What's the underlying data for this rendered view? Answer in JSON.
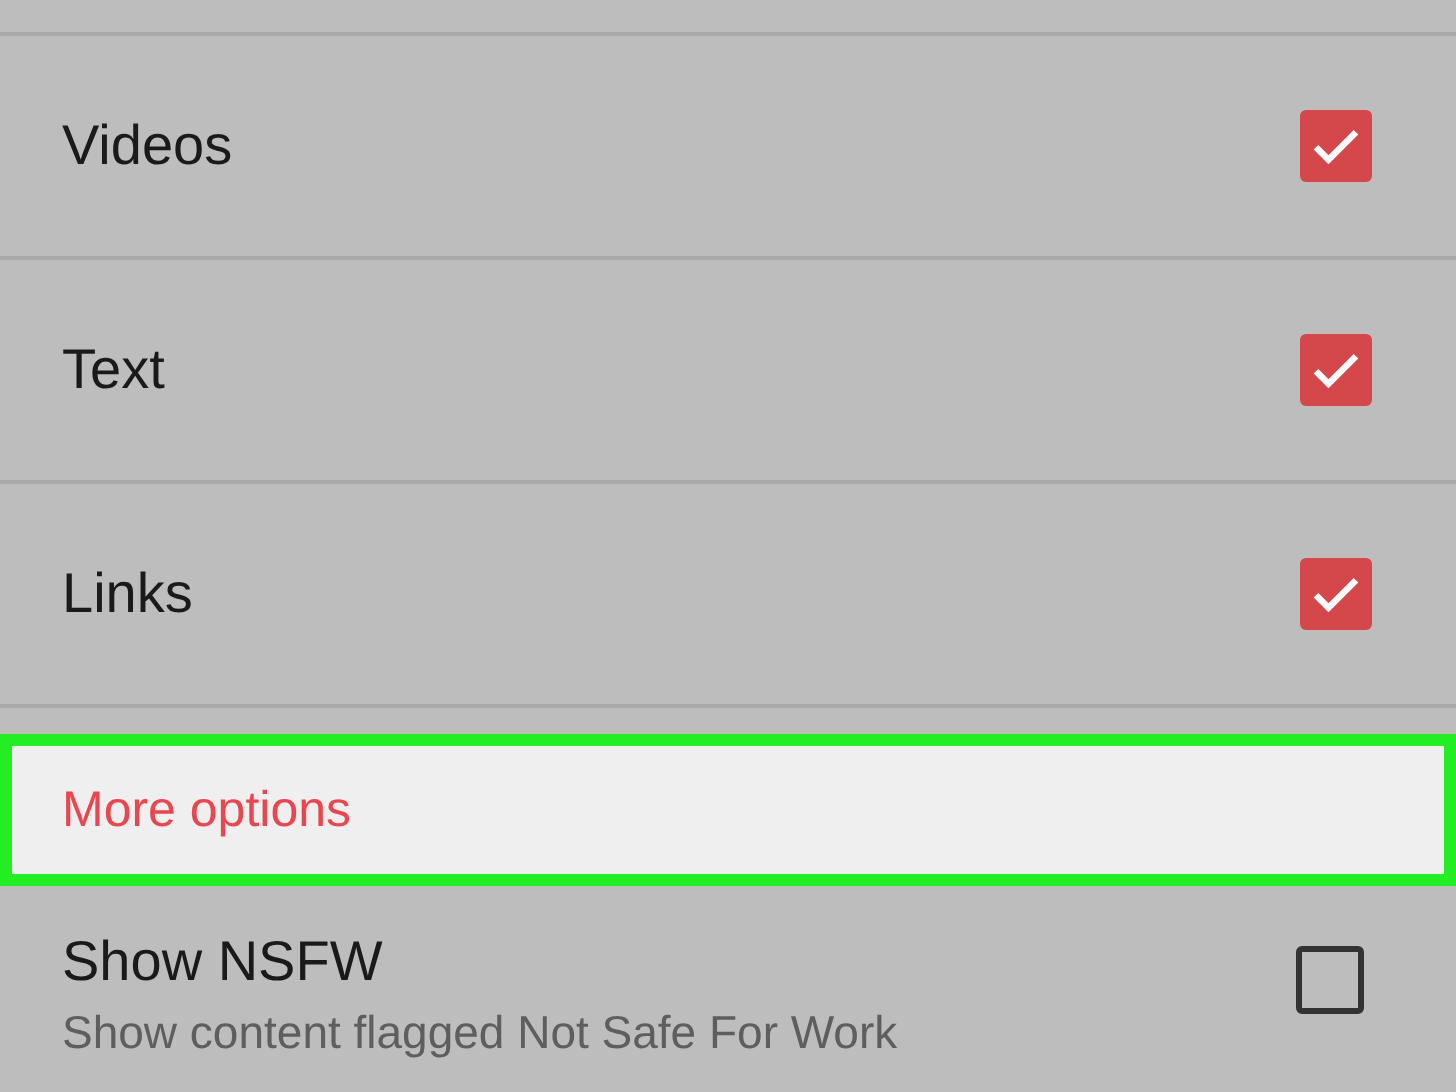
{
  "items": [
    {
      "label": "Videos",
      "checked": true
    },
    {
      "label": "Text",
      "checked": true
    },
    {
      "label": "Links",
      "checked": true
    }
  ],
  "section": {
    "title": "More options",
    "highlighted": true
  },
  "nsfw": {
    "title": "Show NSFW",
    "subtitle": "Show content flagged Not Safe For Work",
    "checked": false
  }
}
